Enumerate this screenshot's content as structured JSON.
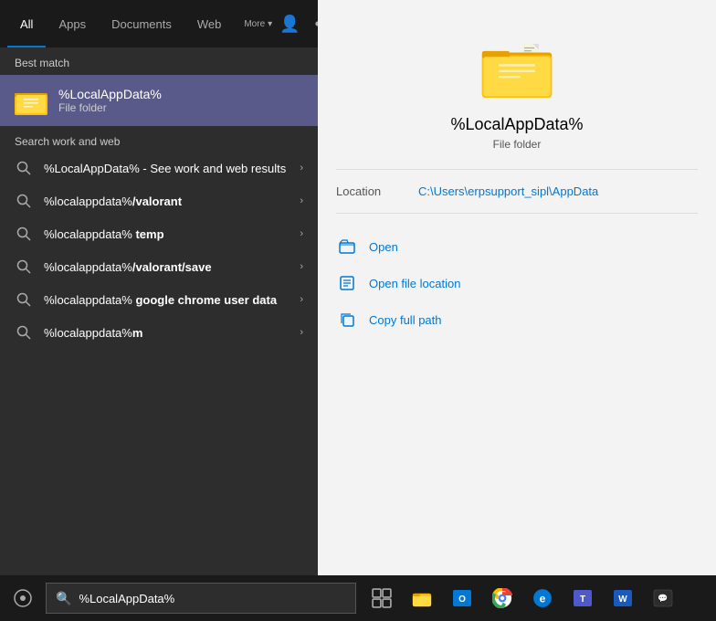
{
  "tabs": {
    "items": [
      {
        "label": "All",
        "active": false
      },
      {
        "label": "Apps",
        "active": false
      },
      {
        "label": "Documents",
        "active": false
      },
      {
        "label": "Web",
        "active": false
      },
      {
        "label": "More",
        "active": false
      }
    ]
  },
  "best_match": {
    "section_label": "Best match",
    "item": {
      "title": "%LocalAppData%",
      "subtitle": "File folder"
    }
  },
  "search_work": {
    "label": "Search work and web",
    "items": [
      {
        "text_plain": "%LocalAppData%",
        "text_suffix": " - See work and web results"
      },
      {
        "text_bold": "%localappdata%",
        "text_suffix": "/valorant"
      },
      {
        "text_bold": "%localappdata%",
        "text_suffix": " temp"
      },
      {
        "text_bold": "%localappdata%",
        "text_suffix": "/valorant/save"
      },
      {
        "text_bold": "%localappdata%",
        "text_suffix": " google chrome user data"
      },
      {
        "text_bold": "%localappdata%",
        "text_suffix": "m"
      }
    ]
  },
  "right_panel": {
    "title": "%LocalAppData%",
    "subtitle": "File folder",
    "location_label": "Location",
    "location_path": "C:\\Users\\erpsupport_sipl\\AppData",
    "actions": [
      {
        "label": "Open"
      },
      {
        "label": "Open file location"
      },
      {
        "label": "Copy full path"
      }
    ]
  },
  "taskbar": {
    "search_placeholder": "%LocalAppData%",
    "search_value": "%LocalAppData%"
  },
  "colors": {
    "accent": "#0078d4",
    "selected_bg": "#5a5a8a",
    "taskbar_bg": "#1a1a1a",
    "left_panel_bg": "#2d2d2d",
    "right_panel_bg": "#f3f3f3"
  }
}
